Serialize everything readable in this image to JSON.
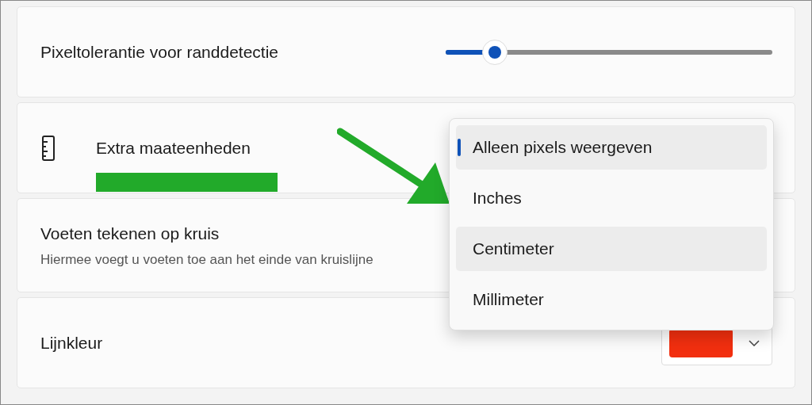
{
  "edge_tolerance": {
    "label": "Pixeltolerantie voor randdetectie",
    "level": 0.15
  },
  "extra_units": {
    "label": "Extra maateenheden"
  },
  "feet": {
    "label": "Voeten tekenen op kruis",
    "description": "Hiermee voegt u voeten toe aan het einde van kruislijne"
  },
  "line_color": {
    "label": "Lijnkleur",
    "color": "#f22f0f"
  },
  "units_menu": [
    {
      "label": "Alleen pixels weergeven",
      "selected": true,
      "highlighted": true
    },
    {
      "label": "Inches",
      "selected": false,
      "highlighted": false
    },
    {
      "label": "Centimeter",
      "selected": false,
      "highlighted": true
    },
    {
      "label": "Millimeter",
      "selected": false,
      "highlighted": false
    }
  ]
}
